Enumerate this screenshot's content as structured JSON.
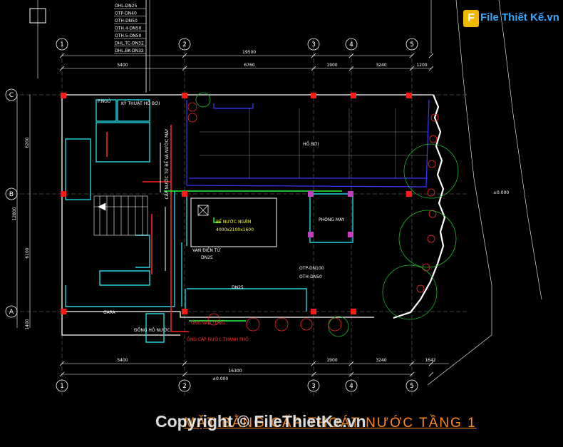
{
  "drawing_title": "MẶT BẰNG CẤP THOÁT NƯỚC TẦNG 1",
  "watermark": "Copyright © FileThietKe.vn",
  "logo": {
    "mark": "F",
    "text": "File Thiết Kế.vn"
  },
  "pipe_legend": [
    "OHL-DN25",
    "OTP-DN40",
    "OTH-DN50",
    "OTH.4-DN50",
    "OTH.5-DN50",
    "DHL.TC-DN32",
    "DHL.BK-DN32"
  ],
  "axes_top": [
    "1",
    "2",
    "3",
    "4",
    "5"
  ],
  "axes_bottom": [
    "1",
    "2",
    "3",
    "4",
    "5"
  ],
  "axes_left": [
    "C",
    "B",
    "A"
  ],
  "dims_top_total": "19500",
  "dims_top": [
    "5400",
    "6760",
    "1900",
    "3240",
    "1200"
  ],
  "dims_bottom": [
    "5400",
    "1900",
    "3240",
    "1642"
  ],
  "dims_bottom_total": "16300",
  "dims_left_total": "12800",
  "dims_left": [
    "6200",
    "6100",
    "1400"
  ],
  "level_right": "±0.000",
  "level_bottom": "±0.000",
  "room_labels": {
    "pool": "HỒ BƠI",
    "water_tank": "BỂ NƯỚC NGẦM",
    "water_tank_size": "4000x2100x1600",
    "pump_room": "PHÒNG MÁY",
    "valve_box": "VAN ĐIỆN TỪ",
    "valve_dn": "DN25",
    "main_dn": "DN25",
    "wc": "P.NGỦ",
    "tech": "KỸ THUẬT HỒ BƠI",
    "garage": "GARA",
    "meter": "ĐỒNG HỒ NƯỚC",
    "otp": "OTP-DN100",
    "oth": "OTH-DN50",
    "valve_note": "ỐNG VAN TỔNG",
    "pipe_note": "ỐNG CẤP NƯỚC THÀNH PHỐ",
    "riser_note": "CẤP NƯỚC TỪ BỂ VÀ NƯỚC MÁY"
  }
}
